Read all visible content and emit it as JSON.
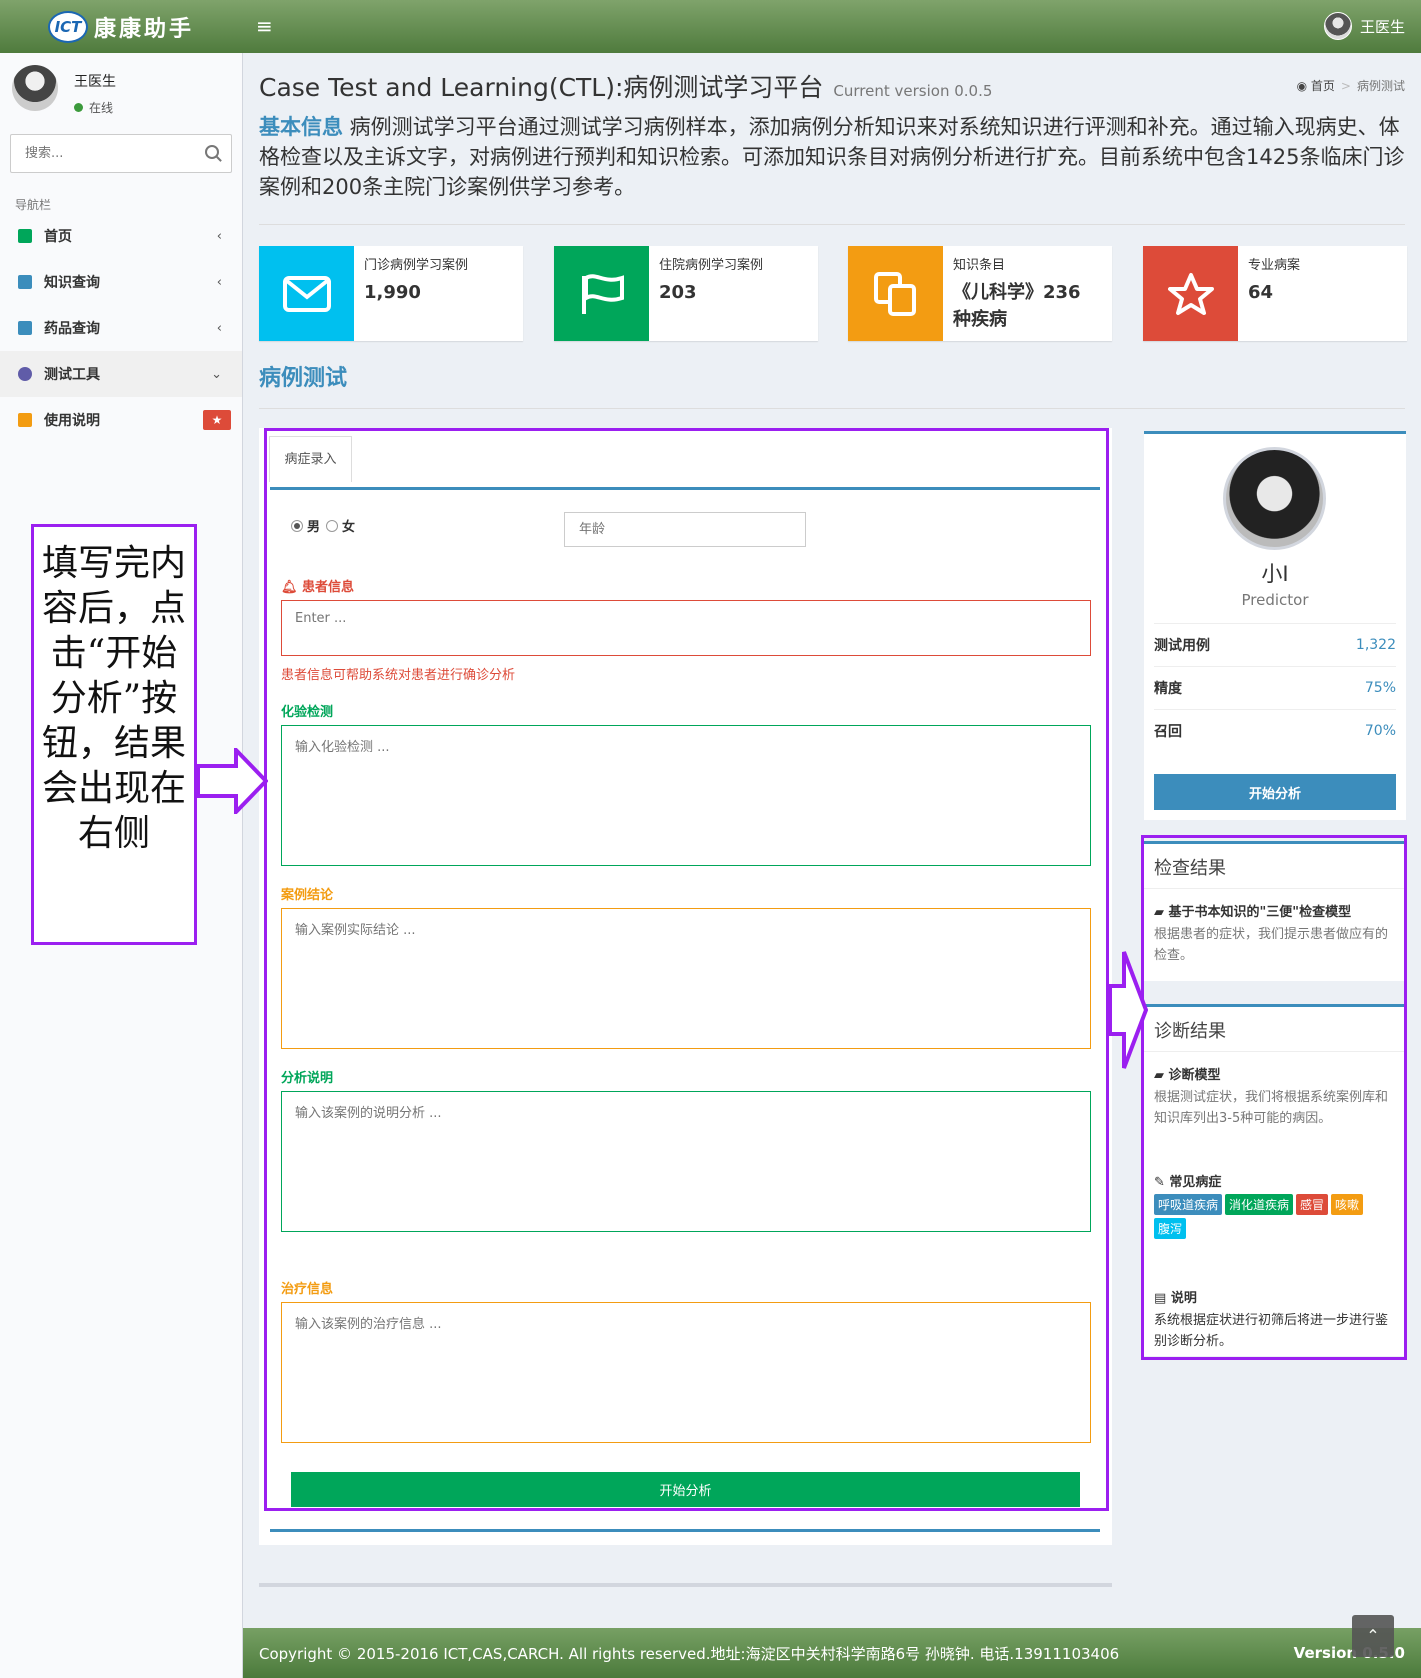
{
  "header": {
    "logo_badge": "ICT",
    "brand": "康康助手",
    "menu_toggle": "≡",
    "user_name": "王医生"
  },
  "sidebar": {
    "user_name": "王医生",
    "user_status": "在线",
    "search_placeholder": "搜索...",
    "nav_header": "导航栏",
    "items": [
      {
        "label": "首页",
        "chevron": "‹",
        "icon_color": "#00a65a"
      },
      {
        "label": "知识查询",
        "chevron": "‹",
        "icon_color": "#3c8dbc"
      },
      {
        "label": "药品查询",
        "chevron": "‹",
        "icon_color": "#3c8dbc"
      },
      {
        "label": "测试工具",
        "chevron": "⌄",
        "icon_color": "#605ca8"
      },
      {
        "label": "使用说明",
        "badge": "★",
        "icon_color": "#f39c12"
      }
    ]
  },
  "page": {
    "title": "Case Test and Learning(CTL):病例测试学习平台",
    "version": "Current version 0.0.5",
    "breadcrumb_home": "首页",
    "breadcrumb_sep": ">",
    "breadcrumb_current": "病例测试",
    "intro_label": "基本信息",
    "intro_text": " 病例测试学习平台通过测试学习病例样本，添加病例分析知识来对系统知识进行评测和补充。通过输入现病史、体格检查以及主诉文字，对病例进行预判和知识检索。可添加知识条目对病例分析进行扩充。目前系统中包含1425条临床门诊案例和200条主院门诊案例供学习参考。",
    "section_title": "病例测试"
  },
  "info_boxes": [
    {
      "label": "门诊病例学习案例",
      "value": "1,990",
      "color": "#00c0ef",
      "icon": "envelope-icon"
    },
    {
      "label": "住院病例学习案例",
      "value": "203",
      "color": "#00a65a",
      "icon": "flag-icon"
    },
    {
      "label": "知识条目",
      "value": "《儿科学》236种疾病",
      "color": "#f39c12",
      "icon": "files-icon"
    },
    {
      "label": "专业病案",
      "value": "64",
      "color": "#dd4b39",
      "icon": "star-icon"
    }
  ],
  "form": {
    "tab": "病症录入",
    "gender_male": "男",
    "gender_female": "女",
    "age_placeholder": "年龄",
    "patient_label": "患者信息",
    "patient_placeholder": "Enter ...",
    "patient_help": "患者信息可帮助系统对患者进行确诊分析",
    "lab_label": "化验检测",
    "lab_placeholder": "输入化验检测 ...",
    "conclusion_label": "案例结论",
    "conclusion_placeholder": "输入案例实际结论 ...",
    "analysis_label": "分析说明",
    "analysis_placeholder": "输入该案例的说明分析 ...",
    "treatment_label": "治疗信息",
    "treatment_placeholder": "输入该案例的治疗信息 ...",
    "submit": "开始分析"
  },
  "profile": {
    "name": "小I",
    "role": "Predictor",
    "rows": [
      {
        "k": "测试用例",
        "v": "1,322"
      },
      {
        "k": "精度",
        "v": "75%"
      },
      {
        "k": "召回",
        "v": "70%"
      }
    ],
    "button": "开始分析"
  },
  "check_result": {
    "title": "检查结果",
    "sub": "基于书本知识的\"三便\"检查模型",
    "text": "根据患者的症状，我们提示患者做应有的检查。"
  },
  "diagnosis_result": {
    "title": "诊断结果",
    "model_sub": "诊断模型",
    "model_text": "根据测试症状，我们将根据系统案例库和知识库列出3-5种可能的病因。",
    "common_sub": "常见病症",
    "tags": [
      {
        "label": "呼吸道疾病",
        "color": "#3c8dbc"
      },
      {
        "label": "消化道疾病",
        "color": "#00a65a"
      },
      {
        "label": "感冒",
        "color": "#dd4b39"
      },
      {
        "label": "咳嗽",
        "color": "#f39c12"
      },
      {
        "label": "腹泻",
        "color": "#00c0ef"
      }
    ],
    "note_sub": "说明",
    "note_text": "系统根据症状进行初筛后将进一步进行鉴别诊断分析。"
  },
  "annotation": {
    "callout": "填写完内容后，点击“开始分析”按钮，结果会出现在右侧"
  },
  "footer": {
    "copyright": "Copyright © 2015-2016 ICT,CAS,CARCH. All rights reserved.地址:海淀区中关村科学南路6号 孙晓钟. 电话.13911103406",
    "version": "Version 0.5.0"
  }
}
